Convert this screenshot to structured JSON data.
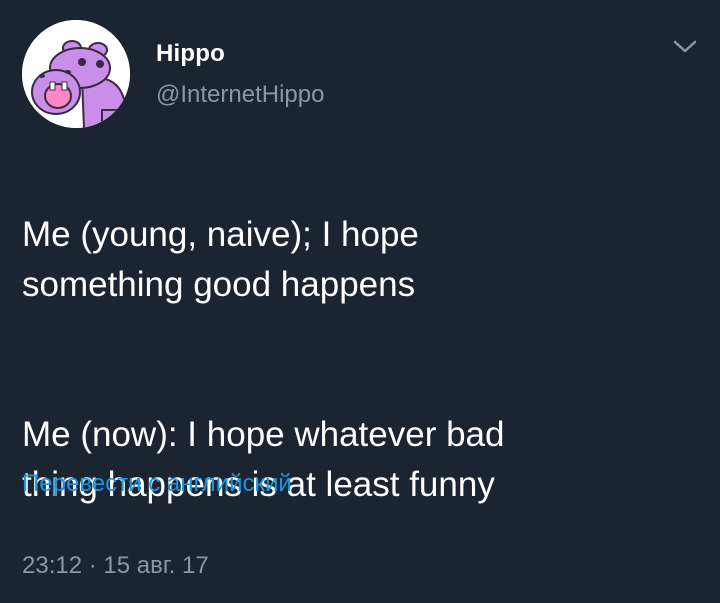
{
  "colors": {
    "background": "#1b2531",
    "text": "#ffffff",
    "muted": "#8899a6",
    "link": "#1b95e0",
    "avatar_hippo": "#c98ee8"
  },
  "author": {
    "display_name": "Hippo",
    "handle": "@InternetHippo",
    "avatar_icon": "hippo-avatar-icon"
  },
  "menu": {
    "icon": "chevron-down-icon"
  },
  "tweet": {
    "paragraphs": [
      "Me (young, naive); I hope\nsomething good happens",
      "Me (now): I hope whatever bad\nthing happens is at least funny"
    ]
  },
  "translate": {
    "label": "Перевести с английский"
  },
  "meta": {
    "timestamp": "23:12 · 15 авг. 17"
  }
}
